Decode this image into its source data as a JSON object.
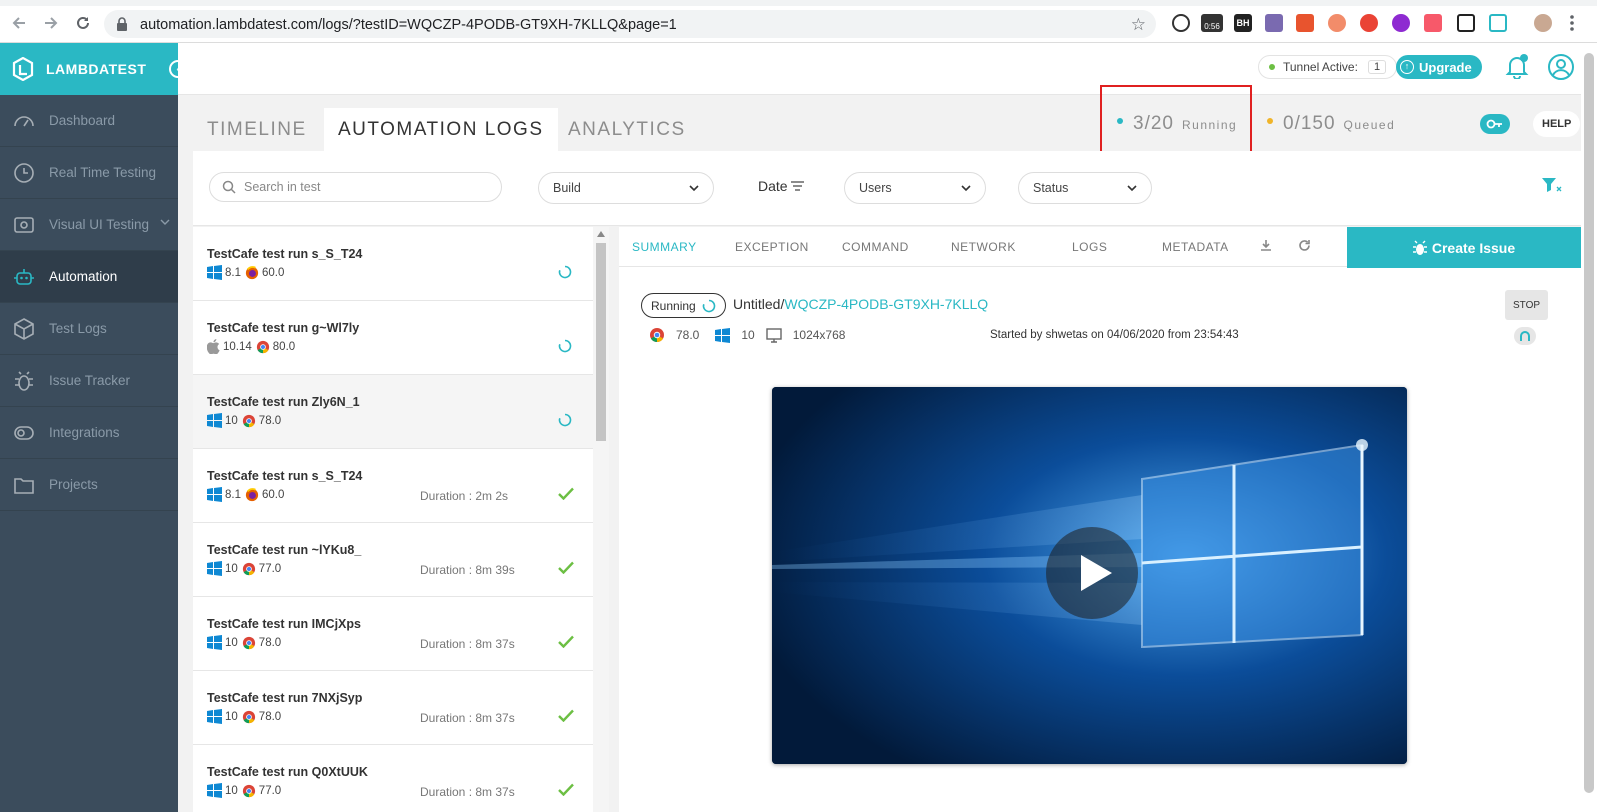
{
  "browser": {
    "url": "automation.lambdatest.com/logs/?testID=WQCZP-4PODB-GT9XH-7KLLQ&page=1",
    "extension_badge": "0:56",
    "extension_bh": "BH"
  },
  "sidebar": {
    "brand": "LAMBDATEST",
    "items": [
      {
        "label": "Dashboard",
        "icon": "gauge-icon"
      },
      {
        "label": "Real Time Testing",
        "icon": "clock-icon"
      },
      {
        "label": "Visual UI Testing",
        "icon": "eye-icon"
      },
      {
        "label": "Automation",
        "icon": "robot-icon"
      },
      {
        "label": "Test Logs",
        "icon": "cube-icon"
      },
      {
        "label": "Issue Tracker",
        "icon": "bug-icon"
      },
      {
        "label": "Integrations",
        "icon": "plug-icon"
      },
      {
        "label": "Projects",
        "icon": "folder-icon"
      }
    ]
  },
  "header": {
    "tunnel_label": "Tunnel Active:",
    "tunnel_count": "1",
    "upgrade_label": "Upgrade",
    "help_label": "HELP"
  },
  "tabs": {
    "timeline": "TIMELINE",
    "automation_logs": "AUTOMATION LOGS",
    "analytics": "ANALYTICS"
  },
  "counters": {
    "running_value": "3/20",
    "running_label": "Running",
    "queued_value": "0/150",
    "queued_label": "Queued"
  },
  "filters": {
    "search_placeholder": "Search in test",
    "build": "Build",
    "date": "Date",
    "users": "Users",
    "status": "Status"
  },
  "tests": [
    {
      "name": "TestCafe test run s_S_T24",
      "os": "windows",
      "os_version": "8.1",
      "browser": "firefox",
      "browser_version": "60.0",
      "duration": "",
      "status": "running"
    },
    {
      "name": "TestCafe test run g~Wl7ly",
      "os": "mac",
      "os_version": "10.14",
      "browser": "chrome",
      "browser_version": "80.0",
      "duration": "",
      "status": "running"
    },
    {
      "name": "TestCafe test run Zly6N_1",
      "os": "windows",
      "os_version": "10",
      "browser": "chrome",
      "browser_version": "78.0",
      "duration": "",
      "status": "running"
    },
    {
      "name": "TestCafe test run s_S_T24",
      "os": "windows",
      "os_version": "8.1",
      "browser": "firefox",
      "browser_version": "60.0",
      "duration": "Duration : 2m 2s",
      "status": "passed"
    },
    {
      "name": "TestCafe test run ~lYKu8_",
      "os": "windows",
      "os_version": "10",
      "browser": "chrome",
      "browser_version": "77.0",
      "duration": "Duration : 8m 39s",
      "status": "passed"
    },
    {
      "name": "TestCafe test run IMCjXps",
      "os": "windows",
      "os_version": "10",
      "browser": "chrome",
      "browser_version": "78.0",
      "duration": "Duration : 8m 37s",
      "status": "passed"
    },
    {
      "name": "TestCafe test run 7NXjSyp",
      "os": "windows",
      "os_version": "10",
      "browser": "chrome",
      "browser_version": "78.0",
      "duration": "Duration : 8m 37s",
      "status": "passed"
    },
    {
      "name": "TestCafe test run Q0XtUUK",
      "os": "windows",
      "os_version": "10",
      "browser": "chrome",
      "browser_version": "77.0",
      "duration": "Duration : 8m 37s",
      "status": "passed"
    }
  ],
  "detail": {
    "tabs": [
      "SUMMARY",
      "EXCEPTION",
      "COMMAND",
      "NETWORK",
      "LOGS",
      "METADATA"
    ],
    "create_issue": "Create Issue",
    "status": "Running",
    "test_prefix": "Untitled/",
    "test_id": "WQCZP-4PODB-GT9XH-7KLLQ",
    "browser_version": "78.0",
    "os_version": "10",
    "resolution": "1024x768",
    "started_by": "Started by shwetas on 04/06/2020 from 23:54:43",
    "stop_label": "STOP"
  },
  "colors": {
    "accent": "#2ab8c4",
    "sidebar": "#3b4c5c",
    "running_dot": "#2ab8c4",
    "queued_dot": "#f0b429",
    "pass": "#6cbf43",
    "highlight": "#e02020"
  }
}
